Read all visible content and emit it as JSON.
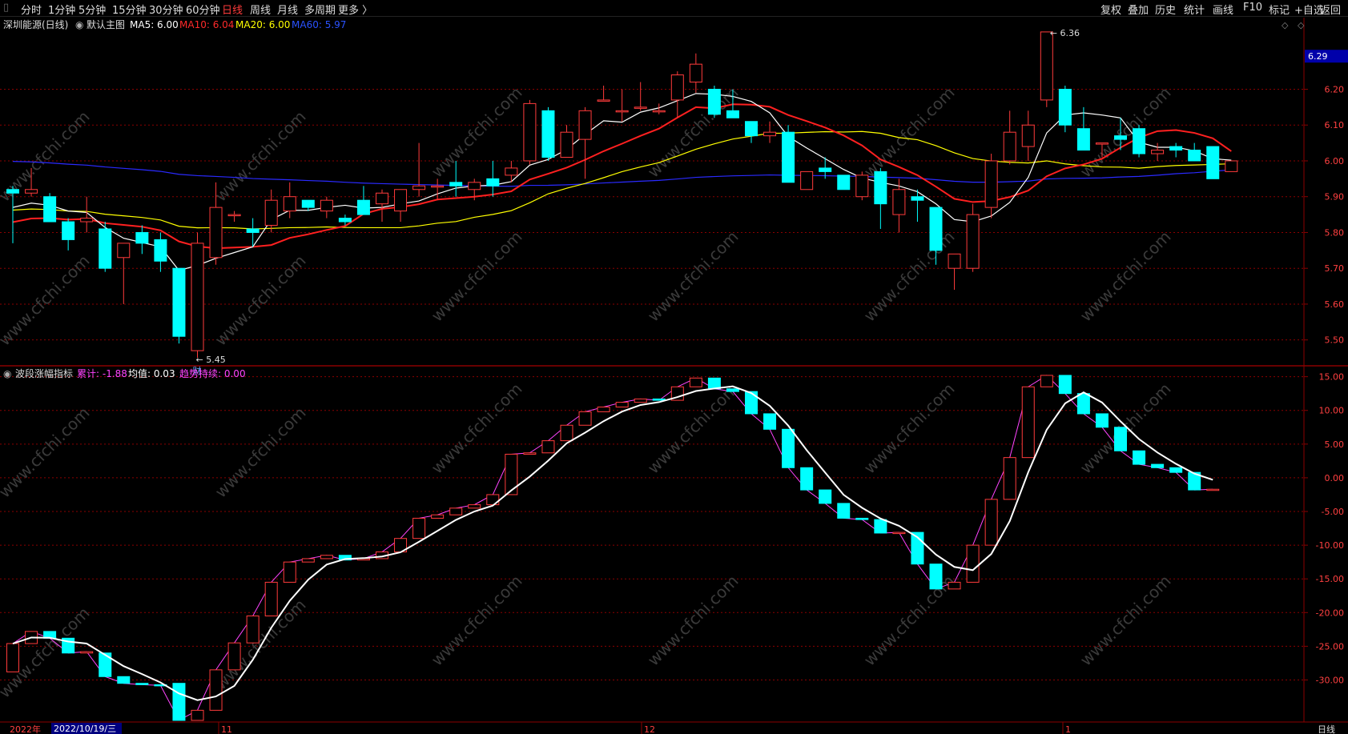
{
  "toolbar": {
    "left_tabs": [
      "分时",
      "1分钟",
      "5分钟",
      "15分钟",
      "30分钟",
      "60分钟",
      "日线",
      "周线",
      "月线",
      "多周期",
      "更多 〉"
    ],
    "active_tab": "日线",
    "right_tabs": [
      "复权",
      "叠加",
      "历史",
      "统计",
      "画线",
      "F10",
      "标记",
      "+自选",
      "返回"
    ]
  },
  "main_panel": {
    "stock_name": "深圳能源(日线)",
    "chart_template": "默认主图",
    "ma_labels": [
      {
        "text": "MA5: 6.00",
        "color": "#ffffff"
      },
      {
        "text": "MA10: 6.04",
        "color": "#ff2a2a"
      },
      {
        "text": "MA20: 6.00",
        "color": "#ffff00"
      },
      {
        "text": "MA60: 5.97",
        "color": "#2a52ff"
      }
    ],
    "current_price_tag": "6.29",
    "high_annotation": "6.36",
    "low_annotation": "5.45",
    "event_marker": "财"
  },
  "sub_panel": {
    "indicator_name": "波段涨幅指标",
    "labels": [
      {
        "text": "累计: -1.88",
        "color": "#ff44ff"
      },
      {
        "text": "均值: 0.03",
        "color": "#ffffff"
      },
      {
        "text": "趋势持续: 0.00",
        "color": "#ff44ff"
      }
    ]
  },
  "x_axis": {
    "labels": [
      "2022年",
      "11",
      "12",
      "1"
    ],
    "cursor_date": "2022/10/19/三",
    "period_label": "日线"
  },
  "watermark": "www.cfchi.com",
  "colors": {
    "up": "#ff3b3b",
    "down": "#00ffff",
    "ma5": "#ffffff",
    "ma10": "#ff2020",
    "ma20": "#ffff00",
    "ma60": "#2a2aff",
    "grid": "#8b0000",
    "axis_text": "#ff4040",
    "sub_line": "#ffffff",
    "sub_connector": "#ff44ff"
  },
  "chart_data": [
    {
      "type": "candlestick",
      "title": "深圳能源(日线)",
      "y_ticks": [
        6.2,
        6.1,
        6.0,
        5.9,
        5.8,
        5.7,
        5.6,
        5.5
      ],
      "ylim": [
        5.43,
        6.4
      ],
      "candles": [
        [
          5.92,
          5.93,
          5.77,
          5.91
        ],
        [
          5.91,
          5.98,
          5.9,
          5.92
        ],
        [
          5.9,
          5.91,
          5.83,
          5.83
        ],
        [
          5.83,
          5.84,
          5.75,
          5.78
        ],
        [
          5.83,
          5.9,
          5.8,
          5.84
        ],
        [
          5.81,
          5.83,
          5.69,
          5.7
        ],
        [
          5.73,
          5.77,
          5.6,
          5.77
        ],
        [
          5.8,
          5.82,
          5.74,
          5.77
        ],
        [
          5.78,
          5.8,
          5.69,
          5.72
        ],
        [
          5.7,
          5.7,
          5.49,
          5.51
        ],
        [
          5.47,
          5.8,
          5.45,
          5.77
        ],
        [
          5.73,
          5.94,
          5.71,
          5.87
        ],
        [
          5.85,
          5.86,
          5.83,
          5.85
        ],
        [
          5.81,
          5.84,
          5.76,
          5.8
        ],
        [
          5.82,
          5.92,
          5.8,
          5.89
        ],
        [
          5.86,
          5.94,
          5.84,
          5.9
        ],
        [
          5.89,
          5.89,
          5.86,
          5.87
        ],
        [
          5.86,
          5.9,
          5.84,
          5.89
        ],
        [
          5.84,
          5.85,
          5.82,
          5.83
        ],
        [
          5.89,
          5.93,
          5.87,
          5.85
        ],
        [
          5.88,
          5.92,
          5.83,
          5.91
        ],
        [
          5.86,
          5.92,
          5.83,
          5.92
        ],
        [
          5.92,
          6.05,
          5.9,
          5.93
        ],
        [
          5.93,
          5.95,
          5.89,
          5.93
        ],
        [
          5.94,
          6.0,
          5.9,
          5.93
        ],
        [
          5.92,
          5.95,
          5.89,
          5.94
        ],
        [
          5.95,
          6.0,
          5.9,
          5.93
        ],
        [
          5.96,
          6.0,
          5.94,
          5.98
        ],
        [
          6.0,
          6.17,
          5.99,
          6.16
        ],
        [
          6.14,
          6.15,
          6.0,
          6.01
        ],
        [
          6.01,
          6.1,
          6.01,
          6.08
        ],
        [
          6.06,
          6.15,
          5.95,
          6.14
        ],
        [
          6.17,
          6.21,
          6.17,
          6.17
        ],
        [
          6.14,
          6.2,
          6.11,
          6.14
        ],
        [
          6.15,
          6.22,
          6.14,
          6.15
        ],
        [
          6.14,
          6.16,
          6.13,
          6.14
        ],
        [
          6.17,
          6.25,
          6.12,
          6.24
        ],
        [
          6.22,
          6.3,
          6.19,
          6.27
        ],
        [
          6.2,
          6.21,
          6.12,
          6.13
        ],
        [
          6.14,
          6.2,
          6.12,
          6.12
        ],
        [
          6.11,
          6.11,
          6.05,
          6.07
        ],
        [
          6.07,
          6.11,
          6.05,
          6.08
        ],
        [
          6.08,
          6.1,
          5.94,
          5.94
        ],
        [
          5.92,
          5.97,
          5.92,
          5.97
        ],
        [
          5.98,
          6.01,
          5.95,
          5.97
        ],
        [
          5.96,
          5.96,
          5.92,
          5.92
        ],
        [
          5.9,
          5.97,
          5.89,
          5.96
        ],
        [
          5.97,
          5.98,
          5.81,
          5.88
        ],
        [
          5.85,
          5.95,
          5.8,
          5.92
        ],
        [
          5.9,
          5.92,
          5.83,
          5.89
        ],
        [
          5.87,
          5.87,
          5.71,
          5.75
        ],
        [
          5.7,
          5.7,
          5.64,
          5.74
        ],
        [
          5.7,
          5.88,
          5.69,
          5.85
        ],
        [
          5.87,
          6.02,
          5.84,
          6.0
        ],
        [
          6.0,
          6.14,
          5.99,
          6.08
        ],
        [
          6.04,
          6.14,
          6.0,
          6.1
        ],
        [
          6.17,
          6.35,
          6.15,
          6.36
        ],
        [
          6.2,
          6.21,
          6.08,
          6.1
        ],
        [
          6.09,
          6.15,
          6.03,
          6.03
        ],
        [
          6.05,
          6.05,
          6.01,
          6.05
        ],
        [
          6.07,
          6.12,
          6.03,
          6.06
        ],
        [
          6.09,
          6.1,
          6.01,
          6.02
        ],
        [
          6.02,
          6.05,
          6.0,
          6.03
        ],
        [
          6.04,
          6.05,
          6.01,
          6.03
        ],
        [
          6.03,
          6.05,
          6.0,
          6.0
        ],
        [
          6.04,
          6.04,
          5.95,
          5.95
        ],
        [
          5.97,
          6.0,
          5.97,
          6.0
        ]
      ]
    },
    {
      "type": "candlestick",
      "title": "波段涨幅指标",
      "y_ticks": [
        15.0,
        10.0,
        5.0,
        0.0,
        -5.0,
        -10.0,
        -15.0,
        -20.0,
        -25.0,
        -30.0
      ],
      "ylim": [
        -36,
        16.5
      ],
      "candles": [
        [
          -28.8,
          -24.6,
          -28.8,
          -24.6
        ],
        [
          -24.6,
          -22.8,
          -24.6,
          -22.8
        ],
        [
          -22.8,
          -22.8,
          -23.8,
          -23.8
        ],
        [
          -23.8,
          -23.8,
          -26.0,
          -26.0
        ],
        [
          -26.0,
          -25.8,
          -26.0,
          -25.8
        ],
        [
          -26.0,
          -26.0,
          -29.5,
          -29.5
        ],
        [
          -29.5,
          -29.5,
          -30.5,
          -30.5
        ],
        [
          -30.5,
          -30.5,
          -30.7,
          -30.7
        ],
        [
          -30.7,
          -30.7,
          -30.8,
          -30.8
        ],
        [
          -30.5,
          -30.5,
          -36.0,
          -36.0
        ],
        [
          -36.0,
          -34.5,
          -36.0,
          -34.5
        ],
        [
          -34.5,
          -28.5,
          -34.5,
          -28.5
        ],
        [
          -28.5,
          -24.5,
          -28.5,
          -24.5
        ],
        [
          -24.5,
          -20.5,
          -24.5,
          -20.5
        ],
        [
          -20.5,
          -15.5,
          -20.5,
          -15.5
        ],
        [
          -15.5,
          -12.5,
          -15.5,
          -12.5
        ],
        [
          -12.5,
          -12.0,
          -12.5,
          -12.0
        ],
        [
          -12.0,
          -11.5,
          -12.0,
          -11.5
        ],
        [
          -11.5,
          -11.5,
          -12.2,
          -12.2
        ],
        [
          -12.2,
          -12.0,
          -12.2,
          -12.0
        ],
        [
          -12.0,
          -11.0,
          -12.0,
          -11.0
        ],
        [
          -11.0,
          -9.0,
          -11.0,
          -9.0
        ],
        [
          -9.0,
          -6.0,
          -9.0,
          -6.0
        ],
        [
          -6.0,
          -5.5,
          -6.0,
          -5.5
        ],
        [
          -5.5,
          -4.5,
          -5.5,
          -4.5
        ],
        [
          -4.5,
          -4.0,
          -4.5,
          -4.0
        ],
        [
          -4.0,
          -2.5,
          -4.0,
          -2.5
        ],
        [
          -2.5,
          3.5,
          -2.5,
          3.5
        ],
        [
          3.5,
          3.7,
          3.5,
          3.7
        ],
        [
          3.7,
          5.5,
          3.7,
          5.5
        ],
        [
          5.5,
          7.8,
          5.5,
          7.8
        ],
        [
          7.8,
          9.8,
          7.8,
          9.8
        ],
        [
          9.8,
          10.5,
          9.8,
          10.5
        ],
        [
          10.5,
          11.2,
          10.5,
          11.2
        ],
        [
          11.2,
          11.7,
          11.2,
          11.7
        ],
        [
          11.7,
          11.7,
          11.5,
          11.5
        ],
        [
          11.5,
          13.5,
          11.5,
          13.5
        ],
        [
          13.5,
          14.8,
          13.5,
          14.8
        ],
        [
          14.8,
          14.8,
          13.2,
          13.2
        ],
        [
          13.2,
          13.2,
          12.8,
          12.8
        ],
        [
          12.8,
          12.8,
          9.5,
          9.5
        ],
        [
          9.5,
          9.5,
          7.2,
          7.2
        ],
        [
          7.2,
          7.2,
          1.5,
          1.5
        ],
        [
          1.5,
          1.5,
          -1.8,
          -1.8
        ],
        [
          -1.8,
          -1.8,
          -3.8,
          -3.8
        ],
        [
          -3.8,
          -3.8,
          -6.0,
          -6.0
        ],
        [
          -6.0,
          -6.0,
          -6.2,
          -6.2
        ],
        [
          -6.2,
          -6.2,
          -8.2,
          -8.2
        ],
        [
          -8.2,
          -8.2,
          -8.1,
          -8.1
        ],
        [
          -8.1,
          -8.1,
          -12.8,
          -12.8
        ],
        [
          -12.8,
          -12.8,
          -16.5,
          -16.5
        ],
        [
          -16.5,
          -15.5,
          -16.5,
          -15.5
        ],
        [
          -15.5,
          -10.0,
          -15.5,
          -10.0
        ],
        [
          -10.0,
          -3.2,
          -10.0,
          -3.2
        ],
        [
          -3.2,
          3.0,
          -3.2,
          3.0
        ],
        [
          3.0,
          13.5,
          3.0,
          13.5
        ],
        [
          13.5,
          15.2,
          13.5,
          15.2
        ],
        [
          15.2,
          15.2,
          12.5,
          12.5
        ],
        [
          12.5,
          12.5,
          9.5,
          9.5
        ],
        [
          9.5,
          9.5,
          7.5,
          7.5
        ],
        [
          7.5,
          7.5,
          4.0,
          4.0
        ],
        [
          4.0,
          4.0,
          2.0,
          2.0
        ],
        [
          2.0,
          2.0,
          1.5,
          1.5
        ],
        [
          1.5,
          1.5,
          0.8,
          0.8
        ],
        [
          0.8,
          0.8,
          -1.8,
          -1.8
        ],
        [
          -1.8,
          -1.7,
          -1.8,
          -1.7
        ]
      ]
    }
  ]
}
